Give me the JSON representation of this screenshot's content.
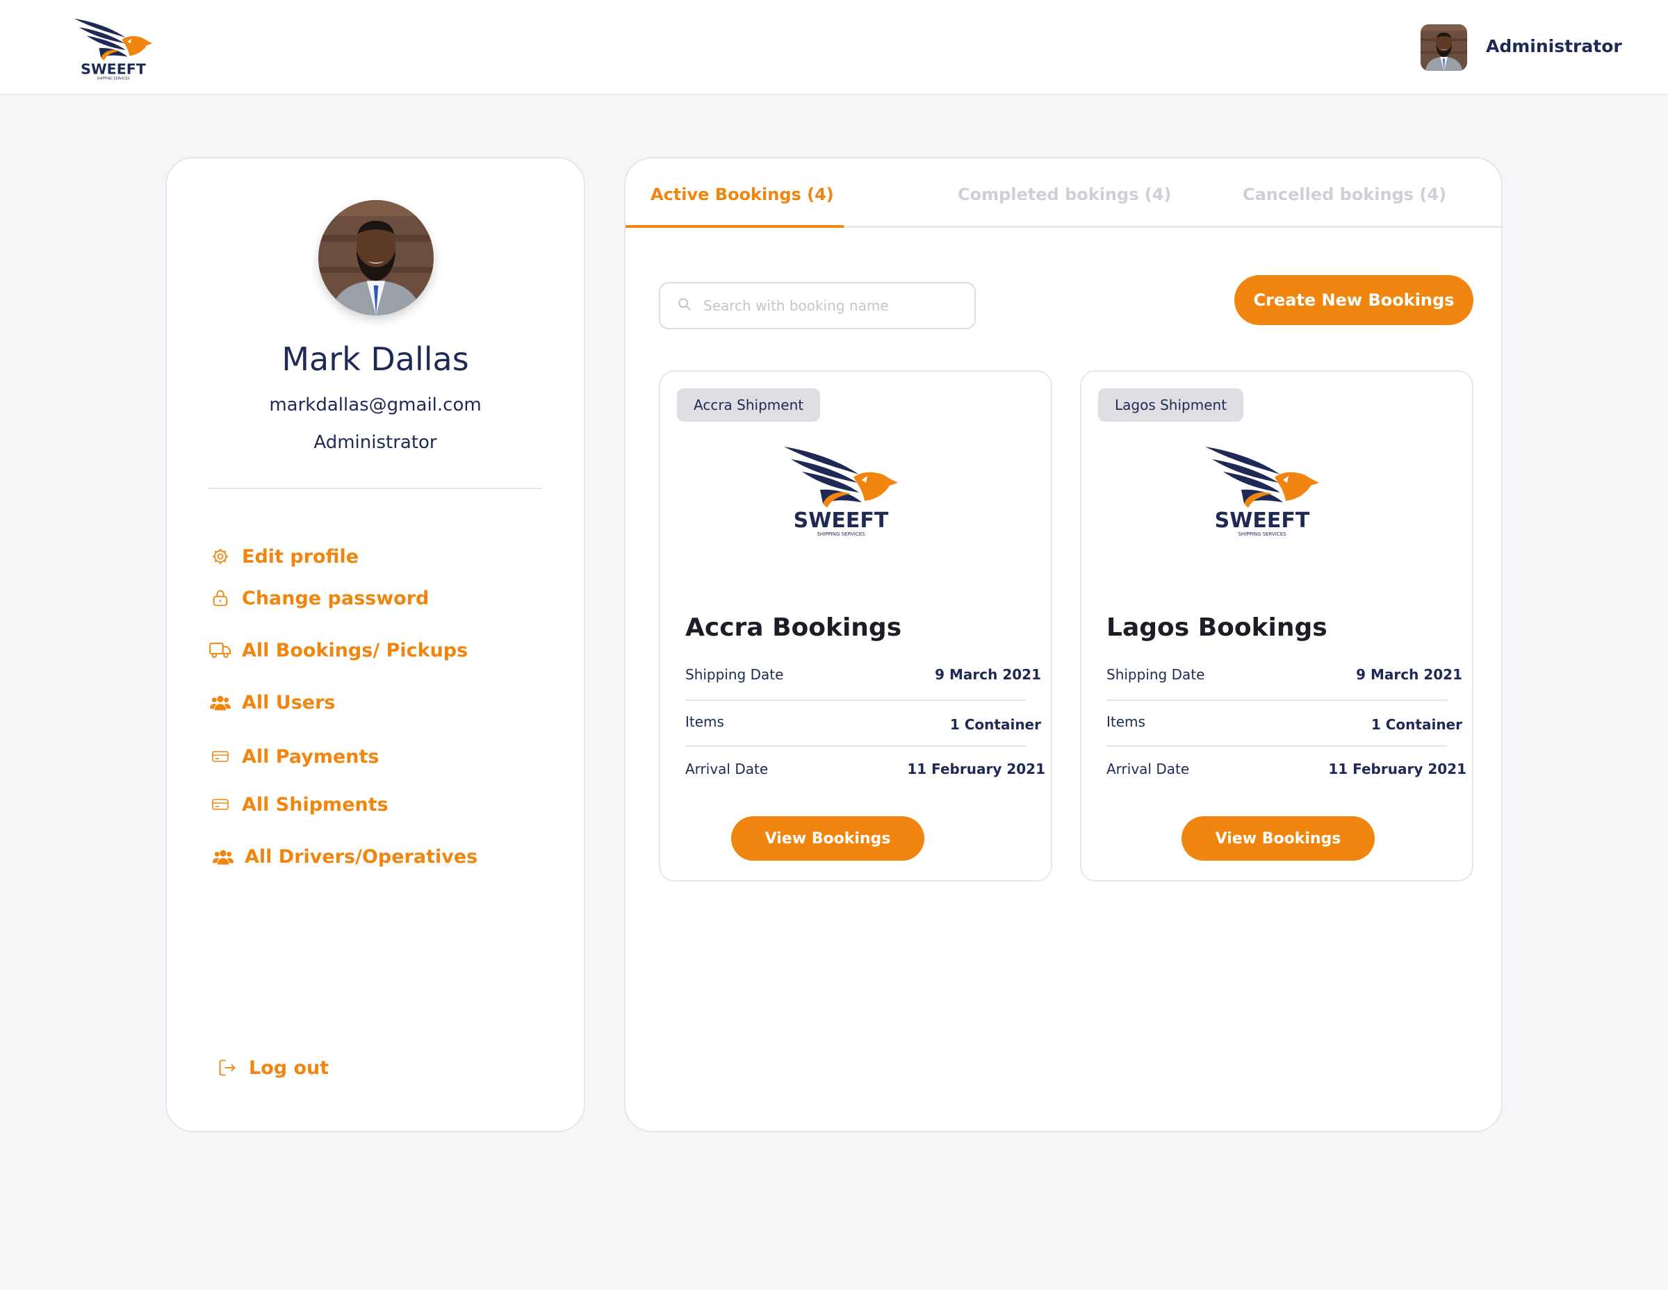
{
  "brand": {
    "logo_text": "SWEEFT",
    "logo_tagline": "SHIPPING SERVICES",
    "primary_color": "#f0860f",
    "navy_color": "#1e2a55"
  },
  "header": {
    "user_role": "Administrator",
    "avatar_icon": "user-avatar"
  },
  "profile": {
    "name": "Mark Dallas",
    "email": "markdallas@gmail.com",
    "role": "Administrator"
  },
  "menu": [
    {
      "label": "Edit profile",
      "icon": "gear-icon"
    },
    {
      "label": "Change password",
      "icon": "lock-icon"
    },
    {
      "label": "All Bookings/ Pickups",
      "icon": "truck-icon"
    },
    {
      "label": "All Users",
      "icon": "users-icon"
    },
    {
      "label": "All Payments",
      "icon": "card-icon"
    },
    {
      "label": "All Shipments",
      "icon": "card-icon"
    },
    {
      "label": "All Drivers/Operatives",
      "icon": "users-icon"
    }
  ],
  "logout": {
    "label": "Log out",
    "icon": "logout-icon"
  },
  "tabs": [
    {
      "label": "Active Bookings (4)",
      "active": true
    },
    {
      "label": "Completed bokings (4)",
      "active": false
    },
    {
      "label": "Cancelled bokings (4)",
      "active": false
    }
  ],
  "search": {
    "placeholder": "Search with booking name",
    "value": ""
  },
  "create_button": "Create New Bookings",
  "bookings": [
    {
      "badge": "Accra Shipment",
      "title": "Accra Bookings",
      "rows": [
        {
          "label": "Shipping Date",
          "value": "9 March 2021"
        },
        {
          "label": "Items",
          "value": "1 Container"
        },
        {
          "label": "Arrival Date",
          "value": "11 February 2021"
        }
      ],
      "button": "View  Bookings"
    },
    {
      "badge": "Lagos Shipment",
      "title": "Lagos Bookings",
      "rows": [
        {
          "label": "Shipping Date",
          "value": "9 March 2021"
        },
        {
          "label": "Items",
          "value": "1 Container"
        },
        {
          "label": "Arrival Date",
          "value": "11 February 2021"
        }
      ],
      "button": "View  Bookings"
    }
  ]
}
